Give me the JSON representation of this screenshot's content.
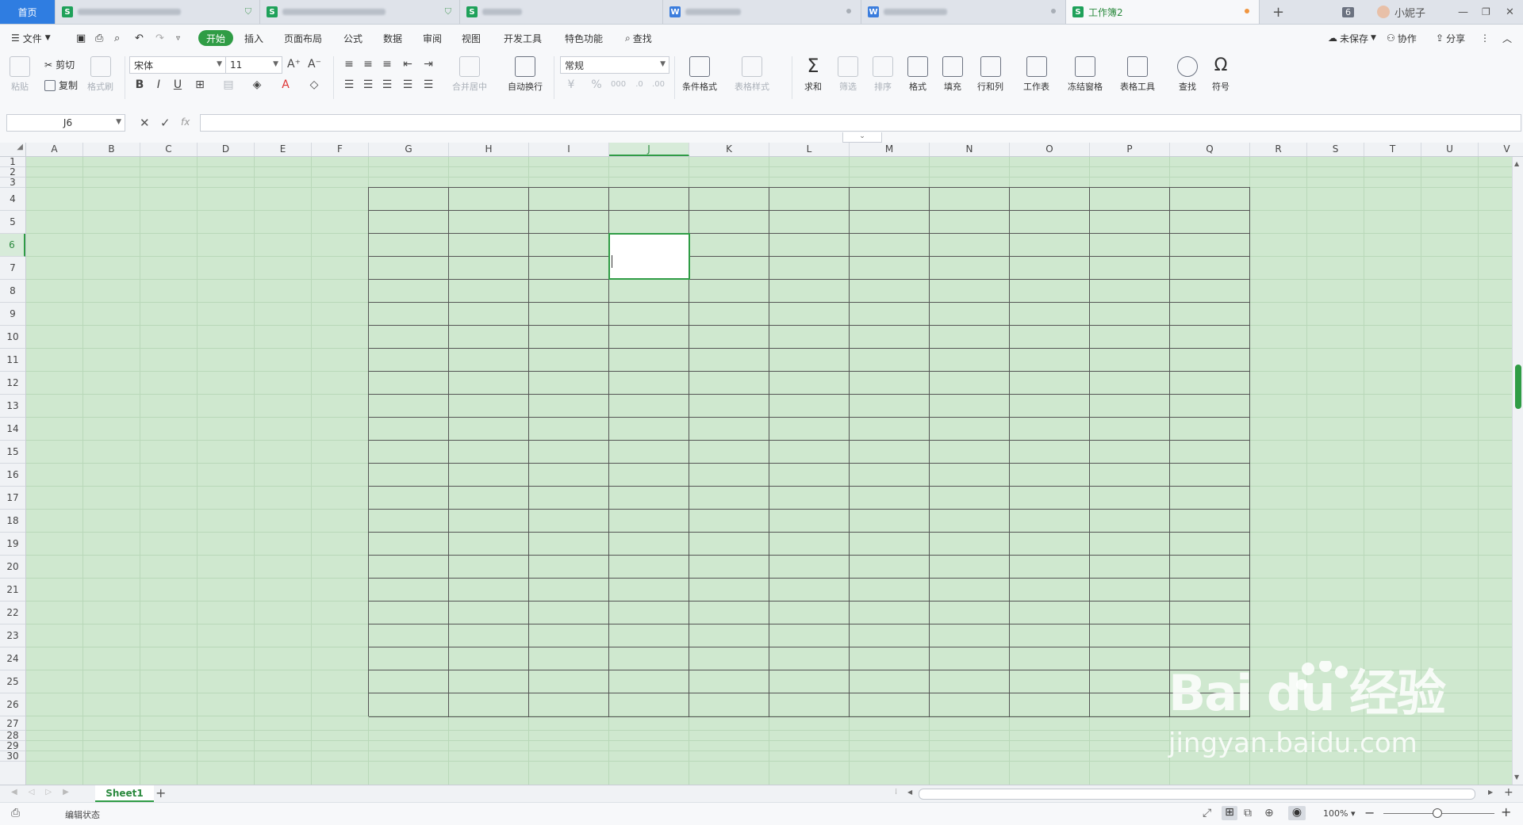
{
  "tabs": {
    "home": "首页",
    "active": "工作簿2",
    "count_badge": "6",
    "user": "小妮子"
  },
  "menu": {
    "file": "文件",
    "start": "开始",
    "items": [
      "插入",
      "页面布局",
      "公式",
      "数据",
      "审阅",
      "视图",
      "开发工具",
      "特色功能"
    ],
    "search": "查找",
    "unsaved": "未保存",
    "collab": "协作",
    "share": "分享"
  },
  "ribbon": {
    "paste": "粘贴",
    "cut": "剪切",
    "copy": "复制",
    "format_painter": "格式刷",
    "font_name": "宋体",
    "font_size": "11",
    "merge_center": "合并居中",
    "wrap_text": "自动换行",
    "number_format": "常规",
    "conditional_format": "条件格式",
    "table_style": "表格样式",
    "sum": "求和",
    "filter": "筛选",
    "sort": "排序",
    "format": "格式",
    "fill": "填充",
    "row_col": "行和列",
    "worksheet": "工作表",
    "freeze": "冻结窗格",
    "table_tools": "表格工具",
    "find": "查找",
    "symbol": "符号"
  },
  "formula_bar": {
    "name_box": "J6",
    "fx": "fx",
    "content": ""
  },
  "columns": [
    "A",
    "B",
    "C",
    "D",
    "E",
    "F",
    "G",
    "H",
    "I",
    "J",
    "K",
    "L",
    "M",
    "N",
    "O",
    "P",
    "Q",
    "R",
    "S",
    "T",
    "U",
    "V"
  ],
  "rows": [
    "1",
    "2",
    "3",
    "4",
    "5",
    "6",
    "7",
    "8",
    "9",
    "10",
    "11",
    "12",
    "13",
    "14",
    "15",
    "16",
    "17",
    "18",
    "19",
    "20",
    "21",
    "22",
    "23",
    "24",
    "25",
    "26",
    "27",
    "28",
    "29",
    "30"
  ],
  "selected_cell": "J6",
  "sheet_tab": "Sheet1",
  "status": {
    "mode": "编辑状态",
    "zoom": "100%"
  },
  "watermark": {
    "brand": "Bai du 经验",
    "url": "jingyan.baidu.com"
  },
  "colors": {
    "accent": "#2f9c45",
    "sheet_bg": "#cfe8cf",
    "home_tab": "#2f7de1"
  }
}
